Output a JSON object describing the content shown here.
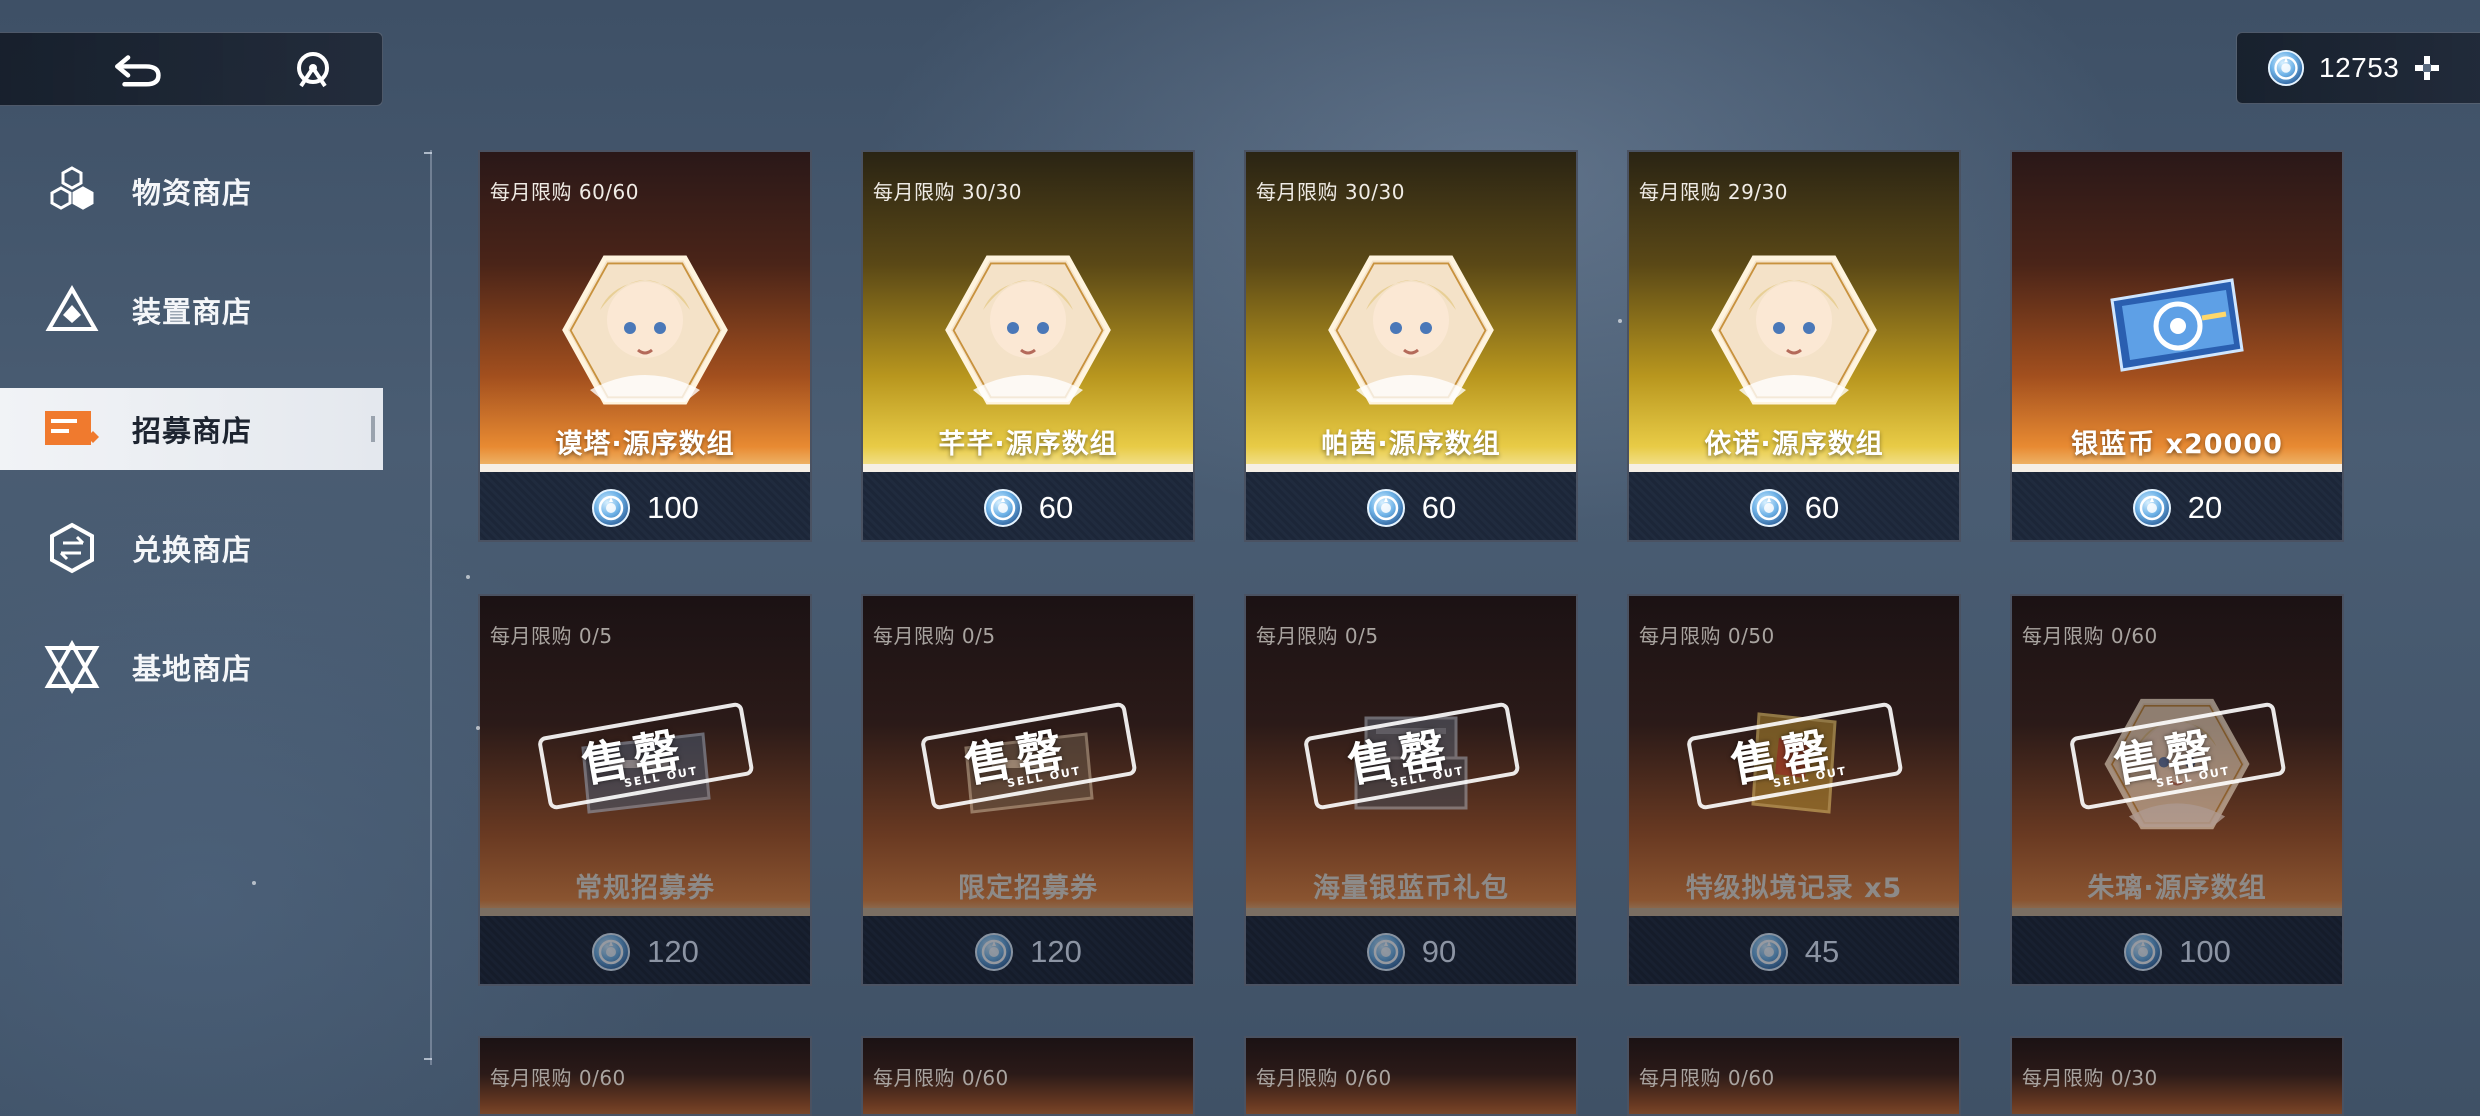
{
  "topbar": {
    "back_icon": "back-arrow-icon",
    "home_icon": "home-emblem-icon",
    "currency_icon": "blue-coin-icon",
    "currency_amount": "12753",
    "add_icon": "plus-icon"
  },
  "sidebar": {
    "items": [
      {
        "label": "物资商店",
        "icon": "hexagon-cluster-icon",
        "active": false
      },
      {
        "label": "装置商店",
        "icon": "triangle-device-icon",
        "active": false
      },
      {
        "label": "招募商店",
        "icon": "recruit-ticket-icon",
        "active": true
      },
      {
        "label": "兑换商店",
        "icon": "exchange-hexagon-icon",
        "active": false
      },
      {
        "label": "基地商店",
        "icon": "base-star-icon",
        "active": false
      }
    ]
  },
  "shop": {
    "sold_out_cn": "售罄",
    "sold_out_en": "SELL OUT",
    "row1": [
      {
        "limit": "每月限购  60/60",
        "name": "谟塔·源序数组",
        "price": "100",
        "theme": "bronze",
        "item": "character-portrait"
      },
      {
        "limit": "每月限购  30/30",
        "name": "芊芊·源序数组",
        "price": "60",
        "theme": "gold",
        "item": "character-portrait"
      },
      {
        "limit": "每月限购  30/30",
        "name": "帕茜·源序数组",
        "price": "60",
        "theme": "gold",
        "item": "character-portrait"
      },
      {
        "limit": "每月限购  29/30",
        "name": "依诺·源序数组",
        "price": "60",
        "theme": "gold",
        "item": "character-portrait"
      },
      {
        "limit": "",
        "name": "银蓝币 x20000",
        "price": "20",
        "theme": "bronze",
        "item": "blue-coin-ticket"
      }
    ],
    "row2": [
      {
        "limit": "每月限购  0/5",
        "name": "常规招募券",
        "price": "120"
      },
      {
        "limit": "每月限购  0/5",
        "name": "限定招募券",
        "price": "120"
      },
      {
        "limit": "每月限购  0/5",
        "name": "海量银蓝币礼包",
        "price": "90"
      },
      {
        "limit": "每月限购  0/50",
        "name": "特级拟境记录 x5",
        "price": "45"
      },
      {
        "limit": "每月限购  0/60",
        "name": "朱璃·源序数组",
        "price": "100"
      }
    ],
    "row3": [
      {
        "limit": "每月限购  0/60"
      },
      {
        "limit": "每月限购  0/60"
      },
      {
        "limit": "每月限购  0/60"
      },
      {
        "limit": "每月限购  0/60"
      },
      {
        "limit": "每月限购  0/30"
      }
    ]
  },
  "colors": {
    "bronze": "#e88a32",
    "gold": "#e8cb46",
    "price_bar": "#1c2638",
    "sidebar_active": "#f1f3f6"
  }
}
